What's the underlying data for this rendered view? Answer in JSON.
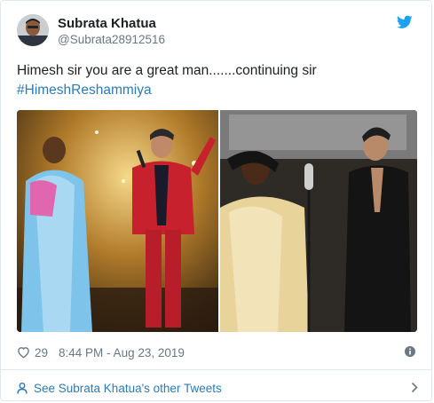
{
  "author": {
    "name": "Subrata Khatua",
    "handle": "@Subrata28912516"
  },
  "tweet": {
    "text": "Himesh sir you are a great man.......continuing sir",
    "hashtag": "#HimeshReshammiya"
  },
  "meta": {
    "likes": "29",
    "timestamp": "8:44 PM - Aug 23, 2019"
  },
  "footer": {
    "link_text": "See Subrata Khatua's other Tweets"
  },
  "icons": {
    "brand": "twitter-bird-icon",
    "like": "heart-icon",
    "info": "info-icon",
    "profile": "person-icon",
    "more": "chevron-right-icon"
  },
  "colors": {
    "link": "#2b7bb9",
    "twitter_blue": "#1da1f2",
    "muted": "#697882",
    "border": "#e1e8ed"
  }
}
